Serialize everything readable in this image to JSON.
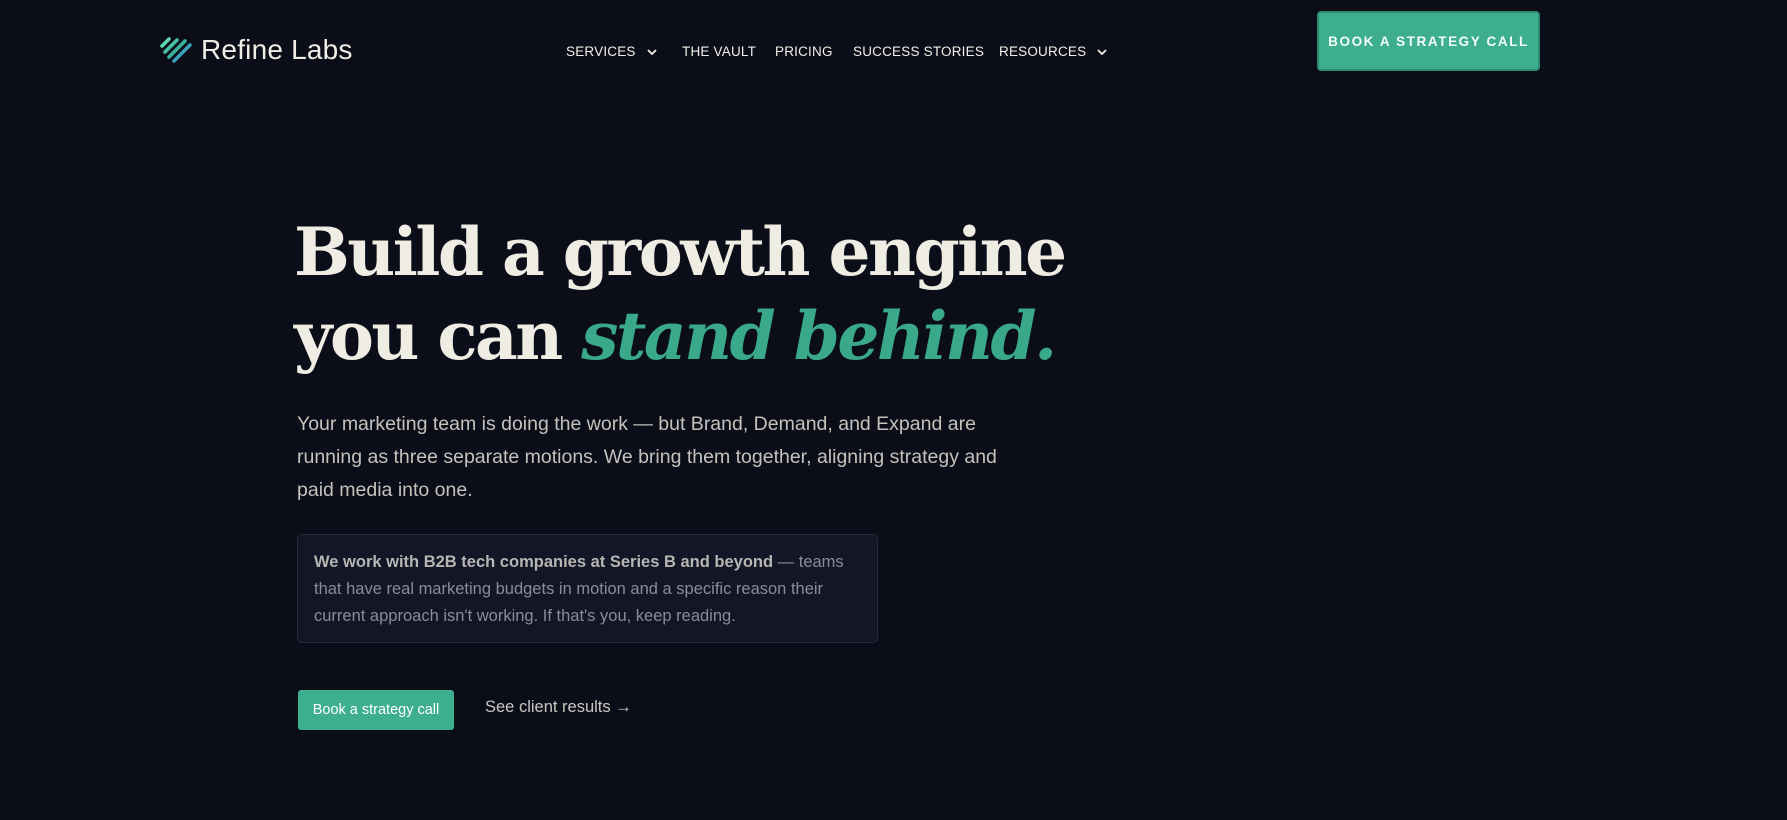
{
  "brand": {
    "name": "Refine Labs",
    "accent": "#3daf8e",
    "icon": "refine-labs-logo-stripes-icon"
  },
  "nav": {
    "items": [
      {
        "label": "SERVICES",
        "dropdown": true
      },
      {
        "label": "THE VAULT",
        "dropdown": false
      },
      {
        "label": "PRICING",
        "dropdown": false
      },
      {
        "label": "SUCCESS STORIES",
        "dropdown": false
      },
      {
        "label": "RESOURCES",
        "dropdown": true
      }
    ],
    "cta_label": "BOOK A STRATEGY CALL"
  },
  "hero": {
    "headline_line1": "Build a growth engine",
    "headline_line2_plain": "you can ",
    "headline_line2_accent": "stand behind.",
    "lead": "Your marketing team is doing the work — but Brand, Demand, and Expand are running as three separate motions. We bring them together, aligning strategy and paid media into one.",
    "note_strong": "We work with B2B tech companies at Series B and beyond",
    "note_rest": " — teams that have real marketing budgets in motion and a specific reason their current approach isn't working. If that's you, keep reading.",
    "primary_button": "Book a strategy call",
    "secondary_link": "See client results →"
  },
  "colors": {
    "background": "#0b0e19",
    "accent": "#3daf8e",
    "note_bg": "#121627"
  }
}
